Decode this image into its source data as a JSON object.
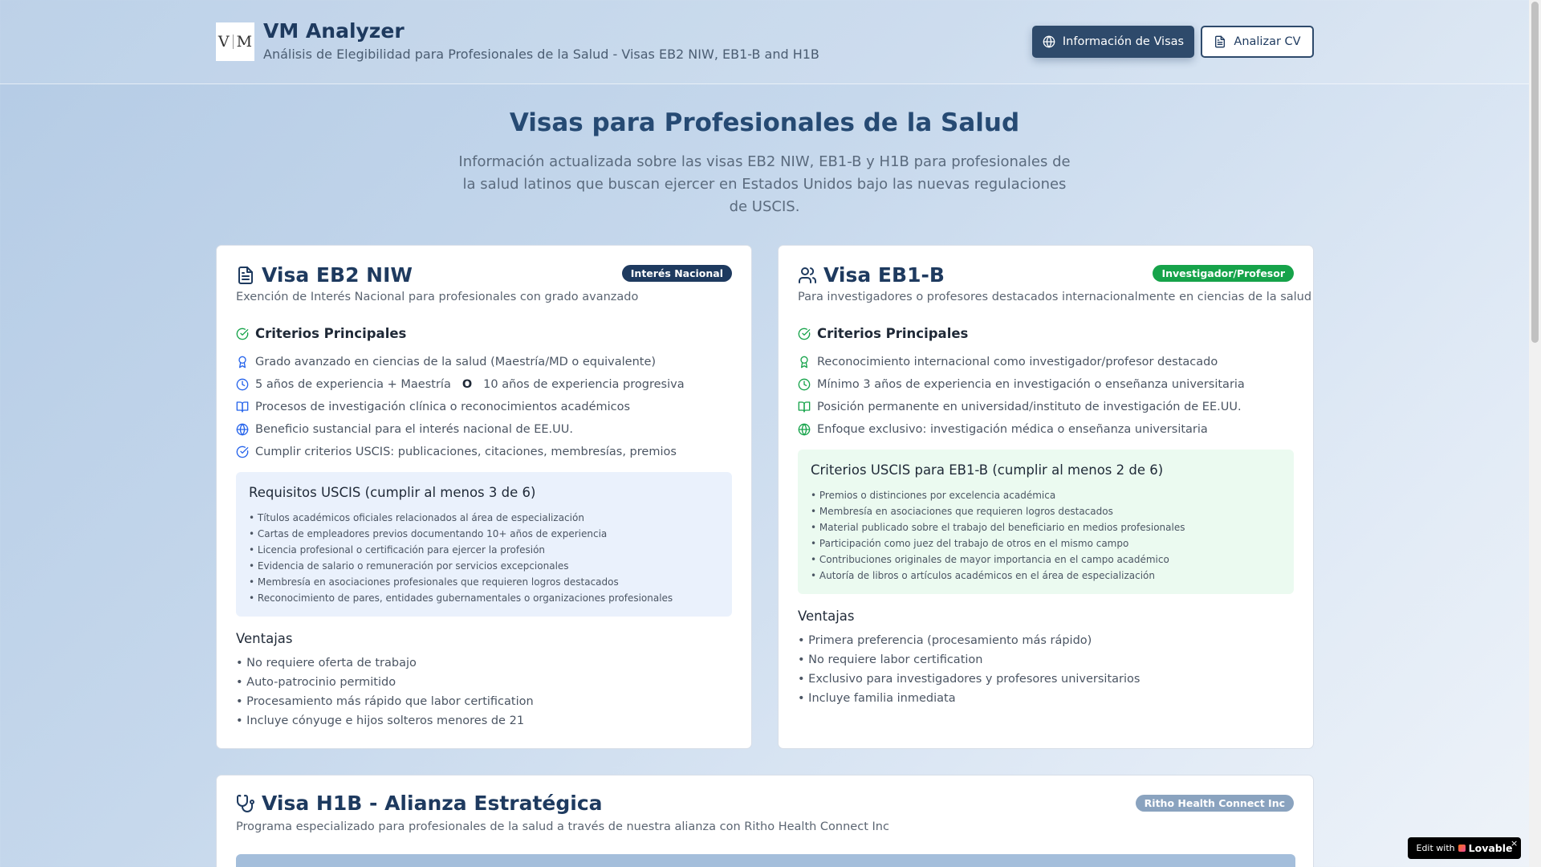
{
  "header": {
    "logo_left": "V",
    "logo_right": "M",
    "title": "VM Analyzer",
    "subtitle": "Análisis de Elegibilidad para Profesionales de la Salud - Visas EB2 NIW, EB1-B and H1B",
    "btn_info": "Información de Visas",
    "btn_cv": "Analizar CV"
  },
  "hero": {
    "title": "Visas para Profesionales de la Salud",
    "description": "Información actualizada sobre las visas EB2 NIW, EB1-B y H1B para profesionales de la salud latinos que buscan ejercer en Estados Unidos bajo las nuevas regulaciones de USCIS."
  },
  "eb2": {
    "title": "Visa EB2 NIW",
    "badge": "Interés Nacional",
    "description": "Exención de Interés Nacional para profesionales con grado avanzado",
    "criteria_title": "Criterios Principales",
    "criteria": [
      "Grado avanzado en ciencias de la salud (Maestría/MD o equivalente)",
      "5 años de experiencia + Maestría",
      "Procesos de investigación clínica o reconocimientos académicos",
      "Beneficio sustancial para el interés nacional de EE.UU.",
      "Cumplir criterios USCIS: publicaciones, citaciones, membresías, premios"
    ],
    "criteria_sep": "O",
    "criteria_alt": "10 años de experiencia progresiva",
    "req_title": "Requisitos USCIS (cumplir al menos 3 de 6)",
    "requirements": [
      "• Títulos académicos oficiales relacionados al área de especialización",
      "• Cartas de empleadores previos documentando 10+ años de experiencia",
      "• Licencia profesional o certificación para ejercer la profesión",
      "• Evidencia de salario o remuneración por servicios excepcionales",
      "• Membresía en asociaciones profesionales que requieren logros destacados",
      "• Reconocimiento de pares, entidades gubernamentales o organizaciones profesionales"
    ],
    "adv_title": "Ventajas",
    "advantages": [
      "• No requiere oferta de trabajo",
      "• Auto-patrocinio permitido",
      "• Procesamiento más rápido que labor certification",
      "• Incluye cónyuge e hijos solteros menores de 21"
    ]
  },
  "eb1": {
    "title": "Visa EB1-B",
    "badge": "Investigador/Profesor",
    "description": "Para investigadores o profesores destacados internacionalmente en ciencias de la salud",
    "criteria_title": "Criterios Principales",
    "criteria": [
      "Reconocimiento internacional como investigador/profesor destacado",
      "Mínimo 3 años de experiencia en investigación o enseñanza universitaria",
      "Posición permanente en universidad/instituto de investigación de EE.UU.",
      "Enfoque exclusivo: investigación médica o enseñanza universitaria"
    ],
    "req_title": "Criterios USCIS para EB1-B (cumplir al menos 2 de 6)",
    "requirements": [
      "• Premios o distinciones por excelencia académica",
      "• Membresía en asociaciones que requieren logros destacados",
      "• Material publicado sobre el trabajo del beneficiario en medios profesionales",
      "• Participación como juez del trabajo de otros en el mismo campo",
      "• Contribuciones originales de mayor importancia en el campo académico",
      "• Autoría de libros o artículos académicos en el área de especialización"
    ],
    "adv_title": "Ventajas",
    "advantages": [
      "• Primera preferencia (procesamiento más rápido)",
      "• No requiere labor certification",
      "• Exclusivo para investigadores y profesores universitarios",
      "• Incluye familia inmediata"
    ]
  },
  "h1b": {
    "title": "Visa H1B - Alianza Estratégica",
    "badge": "Ritho Health Connect Inc",
    "description": "Programa especializado para profesionales de la salud a través de nuestra alianza con Ritho Health Connect Inc"
  },
  "lovable": {
    "prefix": "Edit with",
    "brand": "Lovable",
    "close": "×"
  },
  "colors": {
    "navy": "#1e3a5f",
    "green": "#16a34a",
    "blue_box": "#eaf1fc",
    "green_box": "#ebfaf0"
  },
  "icons": {
    "eb2_title": "file-text-icon",
    "eb1_title": "users-icon",
    "h1b_title": "stethoscope-icon",
    "criteria": [
      "award-icon",
      "clock-icon",
      "book-open-icon",
      "globe-icon",
      "check-circle-icon"
    ]
  }
}
